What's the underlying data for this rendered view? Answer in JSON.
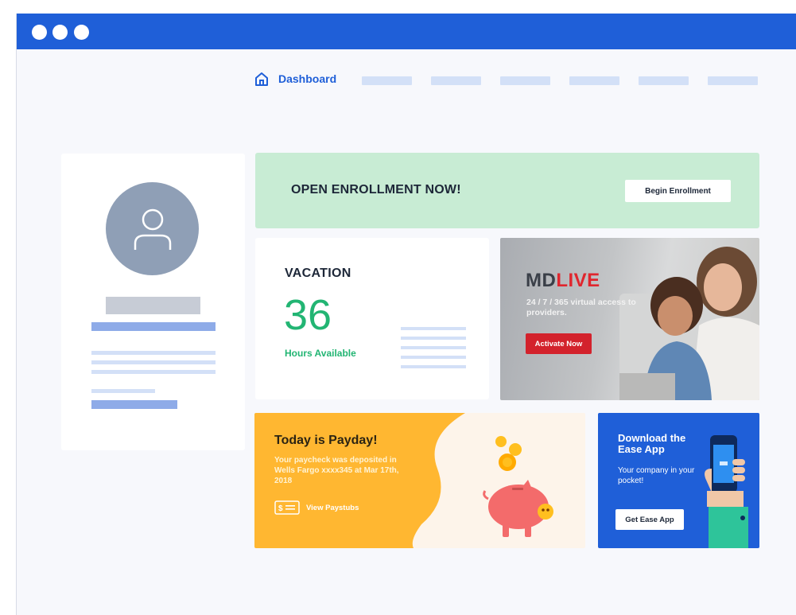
{
  "nav": {
    "home_label": "Dashboard",
    "placeholder_count": 6
  },
  "enrollment": {
    "title": "OPEN ENROLLMENT NOW!",
    "button_label": "Begin Enrollment"
  },
  "vacation": {
    "title": "VACATION",
    "hours": "36",
    "subtitle": "Hours Available"
  },
  "mdlive": {
    "logo_md": "MD",
    "logo_live": "LIVE",
    "text": "24 / 7 / 365 virtual access to providers.",
    "button_label": "Activate Now"
  },
  "payday": {
    "title": "Today is Payday!",
    "text": "Your paycheck was deposited in Wells Fargo xxxx345 at Mar 17th, 2018",
    "link_label": "View Paystubs",
    "money_icon_text": "$"
  },
  "ease": {
    "title": "Download the Ease App",
    "text": "Your company in your pocket!",
    "button_label": "Get Ease App"
  },
  "colors": {
    "brand_blue": "#1f5fd8",
    "enroll_green": "#c8ecd4",
    "vacation_green": "#22b573",
    "mdlive_red": "#d3222c",
    "payday_yellow": "#ffb731",
    "placeholder_blue": "#d3e0f7"
  },
  "icons": {
    "home": "home-icon",
    "avatar": "user-icon",
    "paystub": "money-icon",
    "piggy": "piggy-bank-icon",
    "phone": "phone-icon"
  }
}
